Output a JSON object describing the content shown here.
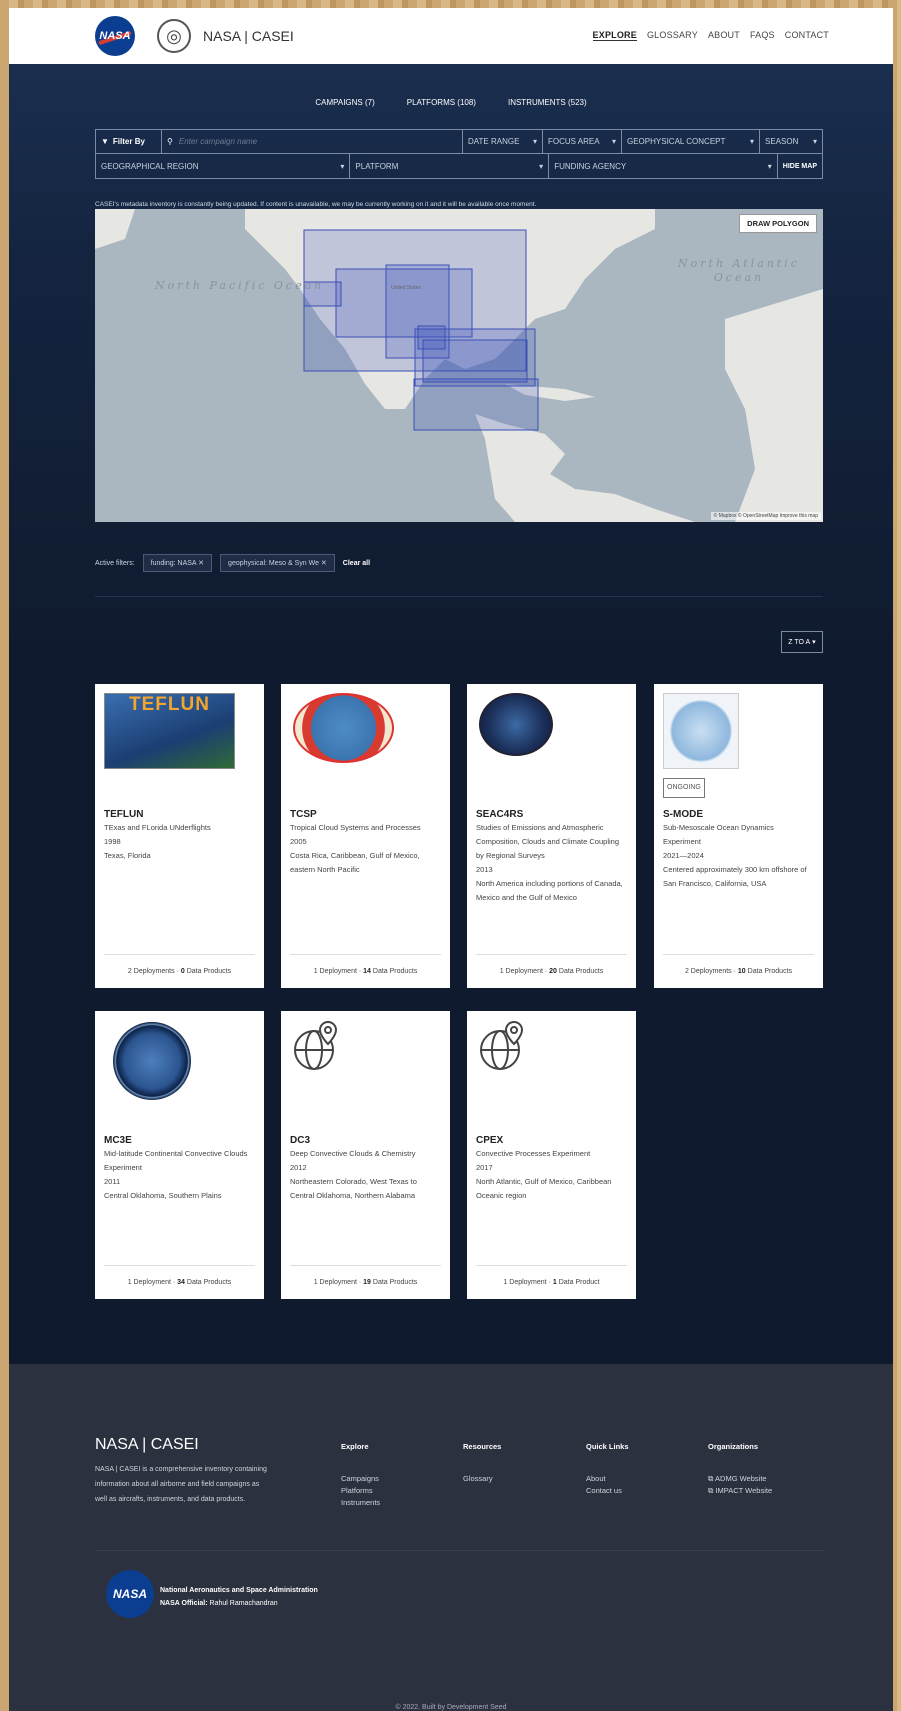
{
  "header": {
    "logo_text": "NASA",
    "brand": "NASA | CASEI",
    "nav": [
      "EXPLORE",
      "GLOSSARY",
      "ABOUT",
      "FAQS",
      "CONTACT"
    ]
  },
  "tabs": [
    "CAMPAIGNS (7)",
    "PLATFORMS (108)",
    "INSTRUMENTS (523)"
  ],
  "filters": {
    "filter_by": "Filter By",
    "search_placeholder": "Enter campaign name",
    "row1": [
      "DATE RANGE",
      "FOCUS AREA",
      "GEOPHYSICAL CONCEPT",
      "SEASON"
    ],
    "row2": [
      "GEOGRAPHICAL REGION",
      "PLATFORM",
      "FUNDING AGENCY"
    ],
    "hide_map": "HIDE MAP"
  },
  "notice": "CASEI's metadata inventory is constantly being updated. If content is unavailable, we may be currently working on it and it will be available once moment.",
  "map": {
    "draw_button": "DRAW POLYGON",
    "ocean_left": "North Pacific Ocean",
    "ocean_right": "North Atlantic Ocean",
    "label_us": "United States",
    "attribution": "© Mapbox © OpenStreetMap Improve this map"
  },
  "active_filters": {
    "label": "Active filters:",
    "chips": [
      "funding: NASA",
      "geophysical: Meso & Syn We"
    ],
    "clear": "Clear all"
  },
  "sort": "Z TO A",
  "cards": [
    {
      "title": "TEFLUN",
      "lines": [
        "TExas and FLorida UNderflights",
        "1998",
        "Texas, Florida"
      ],
      "deploy": "2 Deployments",
      "products": "0",
      "products_label": "Data Products"
    },
    {
      "title": "TCSP",
      "lines": [
        "Tropical Cloud Systems and Processes",
        "2005",
        "Costa Rica, Caribbean, Gulf of Mexico, eastern North Pacific"
      ],
      "deploy": "1 Deployment",
      "products": "14",
      "products_label": "Data Products"
    },
    {
      "title": "SEAC4RS",
      "lines": [
        "Studies of Emissions and Atmospheric Composition, Clouds and Climate Coupling by Regional Surveys",
        "2013",
        "North America including portions of Canada, Mexico and the Gulf of Mexico"
      ],
      "deploy": "1 Deployment",
      "products": "20",
      "products_label": "Data Products"
    },
    {
      "title": "S-MODE",
      "badge": "ONGOING",
      "lines": [
        "Sub-Mesoscale Ocean Dynamics Experiment",
        "2021—2024",
        "Centered approximately 300 km offshore of San Francisco, California, USA"
      ],
      "deploy": "2 Deployments",
      "products": "10",
      "products_label": "Data Products"
    },
    {
      "title": "MC3E",
      "lines": [
        "Mid-latitude Continental Convective Clouds Experiment",
        "2011",
        "Central Oklahoma, Southern Plains"
      ],
      "deploy": "1 Deployment",
      "products": "34",
      "products_label": "Data Products"
    },
    {
      "title": "DC3",
      "lines": [
        "Deep Convective Clouds & Chemistry",
        "2012",
        "Northeastern Colorado, West Texas to Central Oklahoma, Northern Alabama"
      ],
      "deploy": "1 Deployment",
      "products": "19",
      "products_label": "Data Products"
    },
    {
      "title": "CPEX",
      "lines": [
        "Convective Processes Experiment",
        "2017",
        "North Atlantic, Gulf of Mexico, Caribbean Oceanic region"
      ],
      "deploy": "1 Deployment",
      "products": "1",
      "products_label": "Data Product"
    }
  ],
  "card_images": {
    "teflun_banner": "TEFLUN"
  },
  "footer": {
    "brand": "NASA | CASEI",
    "description": "NASA | CASEI is a comprehensive inventory containing information about all airborne and field campaigns as well as aircrafts, instruments, and data products.",
    "columns": [
      {
        "title": "Explore",
        "items": [
          "Campaigns",
          "Platforms",
          "Instruments"
        ]
      },
      {
        "title": "Resources",
        "items": [
          "Glossary"
        ]
      },
      {
        "title": "Quick Links",
        "items": [
          "About",
          "Contact us"
        ]
      },
      {
        "title": "Organizations",
        "items": [
          "ADMG Website",
          "IMPACT Website"
        ]
      }
    ],
    "agency": "National Aeronautics and Space Administration",
    "official_label": "NASA Official:",
    "official_name": "Rahul Ramachandran",
    "copyright": "© 2022. Built by Development Seed"
  },
  "colors": {
    "page_bg": "#0f1a2e",
    "footer_bg": "#2b313e",
    "accent": "#0b3d91",
    "map_box": "#3b4fb8"
  }
}
